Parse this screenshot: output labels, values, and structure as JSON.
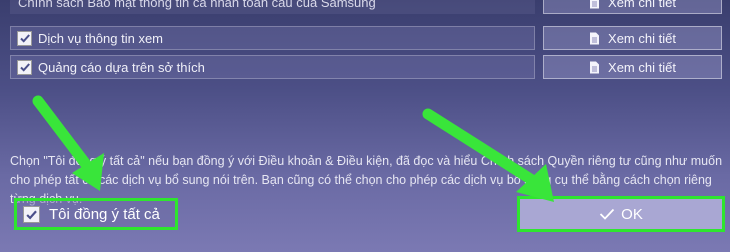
{
  "rows": [
    {
      "label": "Chính sách Bảo mật thông tin cá nhân toàn cầu của Samsung",
      "button": "Xem chi tiết"
    },
    {
      "label": "Dịch vụ thông tin xem",
      "button": "Xem chi tiết"
    },
    {
      "label": "Quảng cáo dựa trên sở thích",
      "button": "Xem chi tiết"
    }
  ],
  "notice": "Chọn \"Tôi đồng ý tất cả\" nếu bạn đồng ý với Điều khoản & Điều kiện, đã đọc và hiểu Chính sách Quyền riêng tư cũng như muốn cho phép tất cả các dịch vụ bổ sung nói trên. Bạn cũng có thể chọn cho phép các dịch vụ bổ sung cụ thể bằng cách chọn riêng từng dịch vụ.",
  "agree_all_label": "Tôi đồng ý tất cả",
  "ok_label": "OK",
  "colors": {
    "highlight": "#2ee62e",
    "ok_button": "#a9a7d3"
  },
  "icons": [
    "checkbox-checked-icon",
    "document-icon",
    "checkmark-icon",
    "green-arrow-annotation"
  ]
}
